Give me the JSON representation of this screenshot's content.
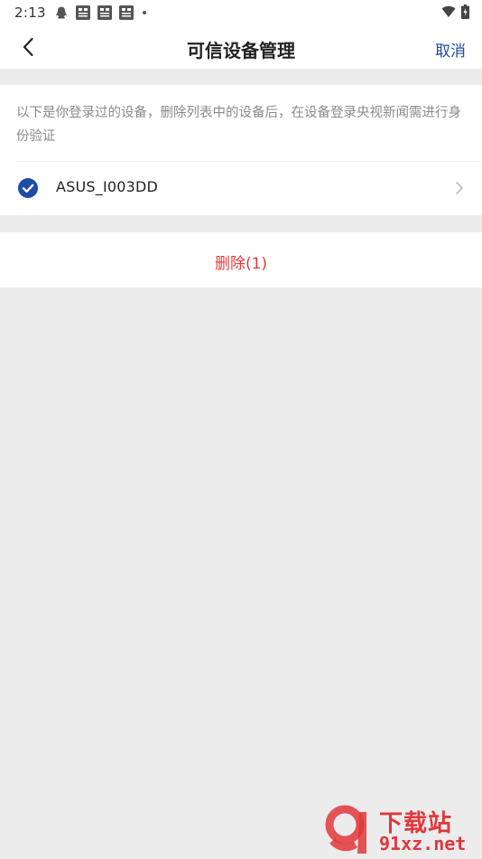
{
  "status_bar": {
    "time": "2:13"
  },
  "nav": {
    "title": "可信设备管理",
    "cancel_label": "取消"
  },
  "info": {
    "text": "以下是你登录过的设备，删除列表中的设备后，在设备登录央视新闻需进行身份验证"
  },
  "devices": [
    {
      "name": "ASUS_I003DD",
      "checked": true
    }
  ],
  "actions": {
    "delete_label": "删除(1)"
  },
  "watermark": {
    "cn": "下载站",
    "url": "91xz.net"
  },
  "colors": {
    "accent": "#1f4ba5",
    "danger": "#e8383d",
    "background": "#ececec"
  }
}
